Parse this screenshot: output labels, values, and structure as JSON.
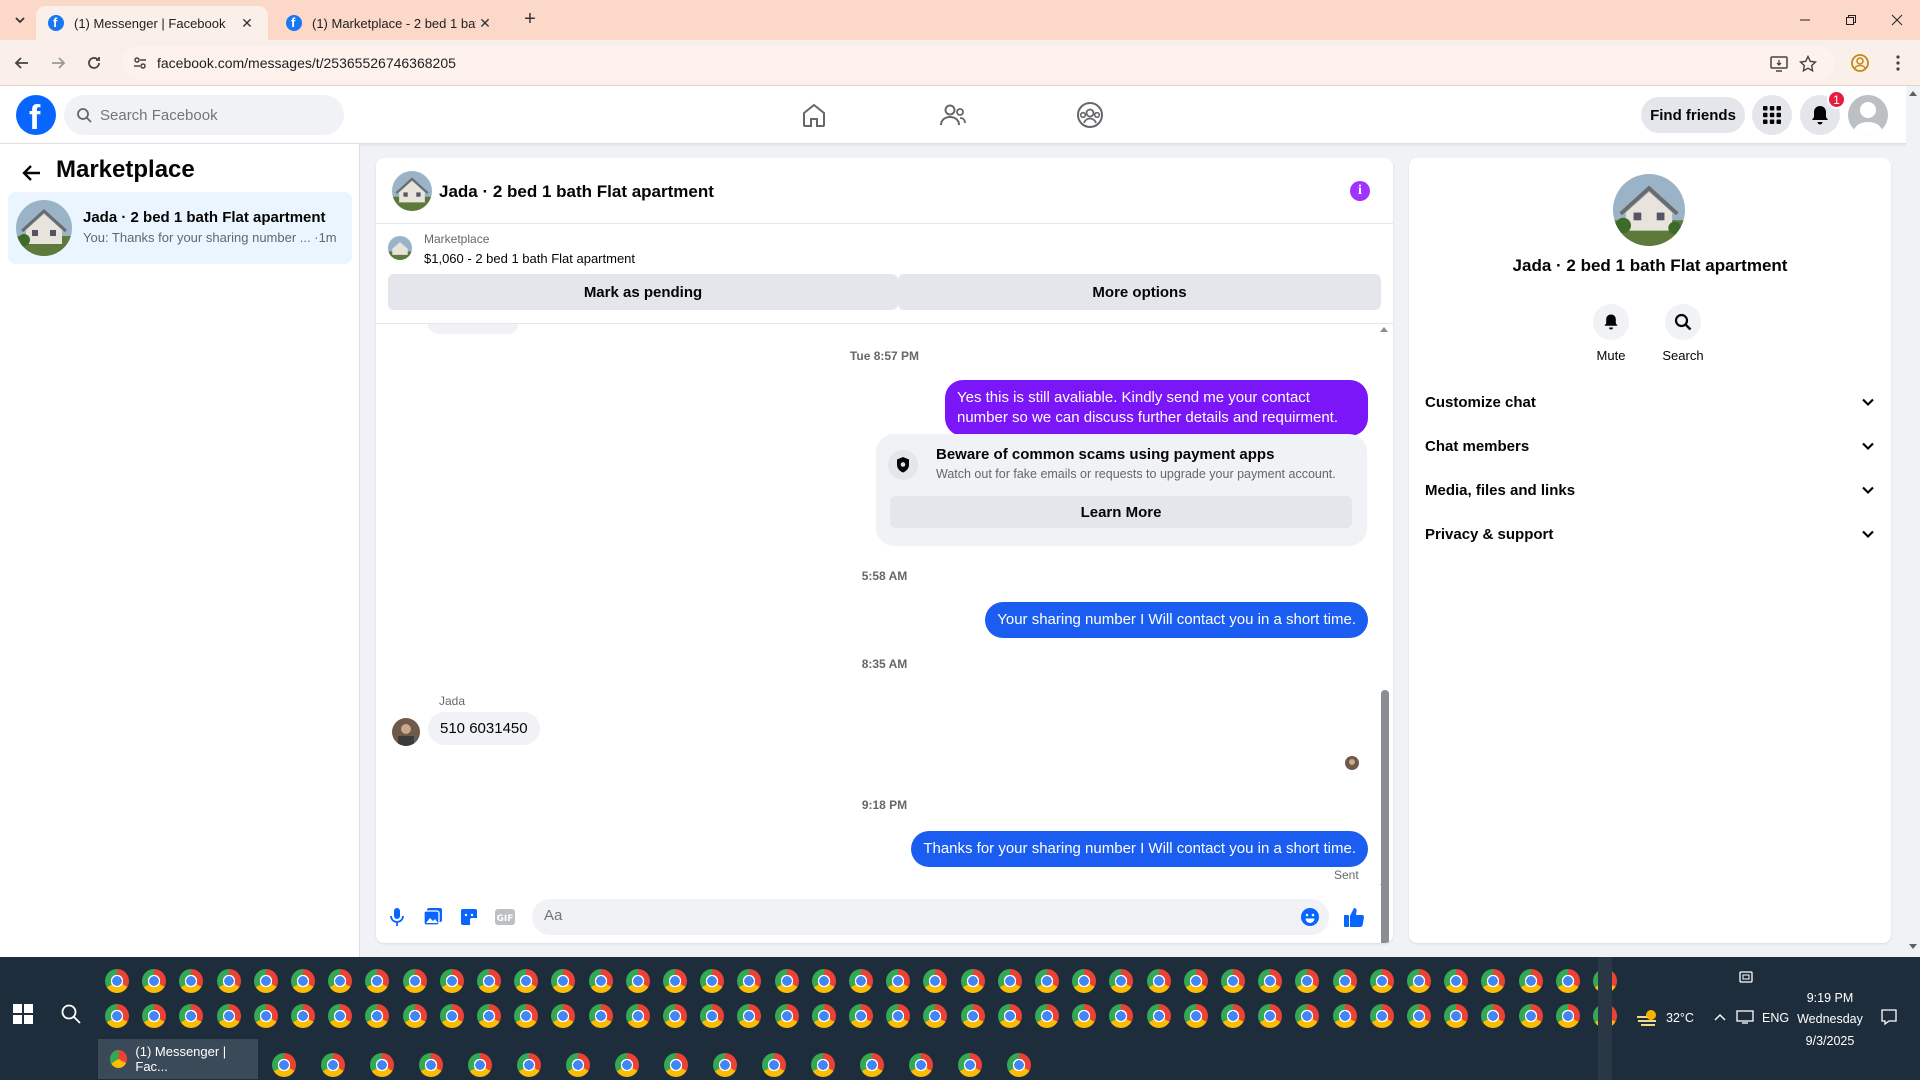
{
  "browser": {
    "tabs": [
      {
        "title": "(1) Messenger | Facebook",
        "active": true
      },
      {
        "title": "(1) Marketplace - 2 bed 1 bath F",
        "active": false
      }
    ],
    "url": "facebook.com/messages/t/25365526746368205"
  },
  "fb_header": {
    "search_placeholder": "Search Facebook",
    "find_friends": "Find friends",
    "notification_count": "1"
  },
  "sidebar": {
    "title": "Marketplace",
    "conversations": [
      {
        "name": "Jada · 2 bed 1 bath Flat apartment",
        "snippet": "You: Thanks for your sharing number ... ·1m"
      }
    ]
  },
  "chat": {
    "title": "Jada · 2 bed 1 bath Flat apartment",
    "listing_label": "Marketplace",
    "listing_price": "$1,060 - 2 bed 1 bath Flat apartment",
    "mark_pending": "Mark as pending",
    "more_options": "More options",
    "messages": [
      {
        "type": "timestamp",
        "text": "Tue 8:57 PM"
      },
      {
        "type": "outgoing",
        "text": "Yes this is still avaliable. Kindly send me your contact number so we can discuss further details and requirment."
      },
      {
        "type": "warning",
        "title": "Beware of common scams using payment apps",
        "desc": "Watch out for fake emails or requests to upgrade your payment account.",
        "button": "Learn More"
      },
      {
        "type": "timestamp",
        "text": "5:58 AM"
      },
      {
        "type": "outgoing",
        "text": "Your sharing number I Will contact you in a short time."
      },
      {
        "type": "timestamp",
        "text": "8:35 AM"
      },
      {
        "type": "incoming",
        "sender": "Jada",
        "text": "510 6031450"
      },
      {
        "type": "timestamp",
        "text": "9:18 PM"
      },
      {
        "type": "outgoing",
        "text": "Thanks for your sharing number I Will contact you in a short time."
      }
    ],
    "status": "Sent",
    "composer_placeholder": "Aa"
  },
  "info_panel": {
    "name": "Jada · 2 bed 1 bath Flat apartment",
    "actions": [
      "Mute",
      "Search"
    ],
    "sections": [
      "Customize chat",
      "Chat members",
      "Media, files and links",
      "Privacy & support"
    ]
  },
  "taskbar": {
    "active_window": "(1) Messenger | Fac...",
    "weather": "32°C",
    "language": "ENG",
    "time": "9:19 PM",
    "day": "Wednesday",
    "date": "9/3/2025"
  },
  "colors": {
    "fb_blue": "#0866ff",
    "bubble_purple": "#7b16f9",
    "bubble_blue": "#1b5df0",
    "selected_row": "#ebf5ff",
    "tabbar": "#fbd8c8"
  }
}
